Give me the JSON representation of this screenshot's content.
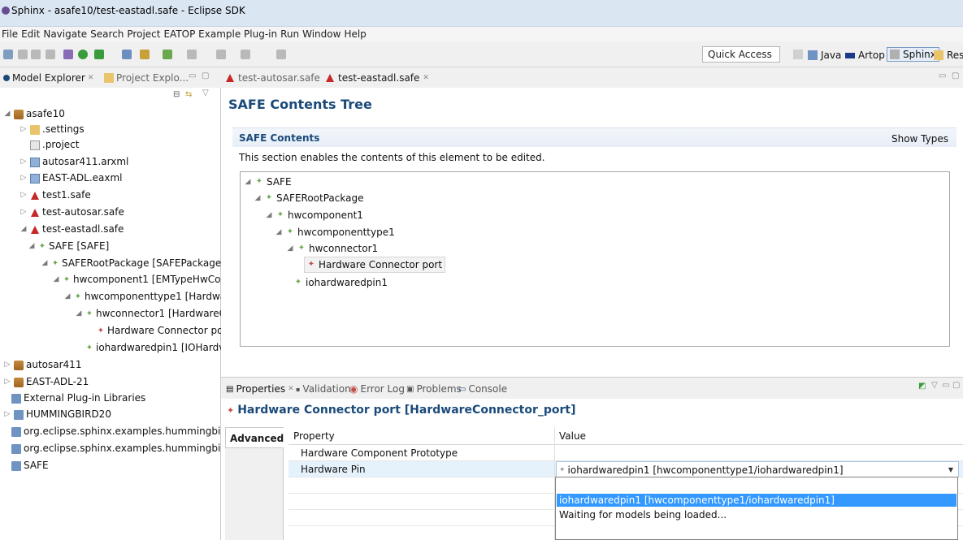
{
  "window": {
    "title": "Sphinx - asafe10/test-eastadl.safe - Eclipse SDK"
  },
  "menu": [
    "File",
    "Edit",
    "Navigate",
    "Search",
    "Project",
    "EATOP Example Plug-in",
    "Run",
    "Window",
    "Help"
  ],
  "toolbar": {
    "quick_access": "Quick Access",
    "perspectives": [
      "Java",
      "Artop",
      "Sphinx",
      "Res"
    ]
  },
  "left_view": {
    "tabs": [
      "Model Explorer",
      "Project Explo..."
    ],
    "tree": [
      {
        "label": "asafe10",
        "icon": "project-icon"
      },
      {
        "label": ".settings",
        "icon": "folder-icon"
      },
      {
        "label": ".project",
        "icon": "file-icon"
      },
      {
        "label": "autosar411.arxml",
        "icon": "arxml-icon"
      },
      {
        "label": "EAST-ADL.eaxml",
        "icon": "eaxml-icon"
      },
      {
        "label": "test1.safe",
        "icon": "safe-icon"
      },
      {
        "label": "test-autosar.safe",
        "icon": "safe-icon"
      },
      {
        "label": "test-eastadl.safe",
        "icon": "safe-icon"
      },
      {
        "label": "SAFE [SAFE]",
        "icon": "element-icon"
      },
      {
        "label": "SAFERootPackage [SAFEPackage]",
        "icon": "element-icon"
      },
      {
        "label": "hwcomponent1 [EMTypeHwCo",
        "icon": "element-icon"
      },
      {
        "label": "hwcomponenttype1 [Hardwa",
        "icon": "element-icon"
      },
      {
        "label": "hwconnector1 [HardwareC",
        "icon": "element-icon"
      },
      {
        "label": "Hardware Connector po",
        "icon": "port-icon"
      },
      {
        "label": "iohardwaredpin1 [IOHardv",
        "icon": "element-icon"
      },
      {
        "label": "autosar411",
        "icon": "project-icon"
      },
      {
        "label": "EAST-ADL-21",
        "icon": "project-icon"
      },
      {
        "label": "External Plug-in Libraries",
        "icon": "library-icon"
      },
      {
        "label": "HUMMINGBIRD20",
        "icon": "library-icon"
      },
      {
        "label": "org.eclipse.sphinx.examples.hummingbir",
        "icon": "library-icon"
      },
      {
        "label": "org.eclipse.sphinx.examples.hummingbir",
        "icon": "library-icon"
      },
      {
        "label": "SAFE",
        "icon": "library-icon"
      }
    ]
  },
  "editor": {
    "tabs": [
      "test-autosar.safe",
      "test-eastadl.safe"
    ],
    "title": "SAFE Contents Tree",
    "section_title": "SAFE Contents",
    "show_types": "Show Types",
    "description": "This section enables the contents of this element to be edited.",
    "tree": [
      {
        "label": "SAFE"
      },
      {
        "label": "SAFERootPackage"
      },
      {
        "label": "hwcomponent1"
      },
      {
        "label": "hwcomponenttype1"
      },
      {
        "label": "hwconnector1"
      },
      {
        "label": "Hardware Connector port"
      },
      {
        "label": "iohardwaredpin1"
      }
    ]
  },
  "properties": {
    "tabs": [
      "Properties",
      "Validation",
      "Error Log",
      "Problems",
      "Console"
    ],
    "title": "Hardware Connector port [HardwareConnector_port]",
    "side_tab": "Advanced",
    "columns": [
      "Property",
      "Value"
    ],
    "rows": [
      {
        "property": "Hardware Component Prototype",
        "value": ""
      },
      {
        "property": "Hardware Pin",
        "value": "iohardwaredpin1 [hwcomponenttype1/iohardwaredpin1]"
      }
    ],
    "dropdown_options": [
      "",
      "iohardwaredpin1 [hwcomponenttype1/iohardwaredpin1]",
      "Waiting for models being loaded..."
    ]
  }
}
